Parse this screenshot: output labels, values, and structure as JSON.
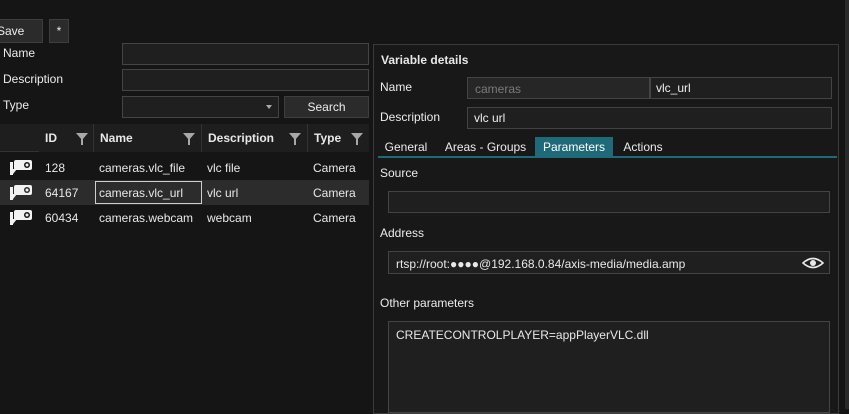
{
  "toolbar": {
    "save_label": "Save",
    "star_label": "*"
  },
  "filters": {
    "name_label": "Name",
    "name_value": "",
    "description_label": "Description",
    "description_value": "",
    "type_label": "Type",
    "type_value": "",
    "search_label": "Search"
  },
  "table": {
    "columns": [
      "ID",
      "Name",
      "Description",
      "Type"
    ],
    "rows": [
      {
        "id": "128",
        "name": "cameras.vlc_file",
        "description": "vlc file",
        "type": "Camera",
        "icon": "camera-icon"
      },
      {
        "id": "64167",
        "name": "cameras.vlc_url",
        "description": "vlc url",
        "type": "Camera",
        "icon": "camera-icon"
      },
      {
        "id": "60434",
        "name": "cameras.webcam",
        "description": "webcam",
        "type": "Camera",
        "icon": "camera-icon"
      }
    ]
  },
  "details": {
    "title": "Variable details",
    "name_label": "Name",
    "name_prefix": "cameras",
    "name_value": "vlc_url",
    "description_label": "Description",
    "description_value": "vlc url",
    "tabs": [
      "General",
      "Areas - Groups",
      "Parameters",
      "Actions"
    ],
    "active_tab": "Parameters",
    "source_label": "Source",
    "source_value": "",
    "address_label": "Address",
    "address_value": "rtsp://root:●●●●@192.168.0.84/axis-media/media.amp",
    "other_label": "Other parameters",
    "other_value": "CREATECONTROLPLAYER=appPlayerVLC.dll"
  },
  "colors": {
    "accent": "#1f6a78",
    "background": "#151515",
    "selected_row": "#2c2c2c"
  }
}
